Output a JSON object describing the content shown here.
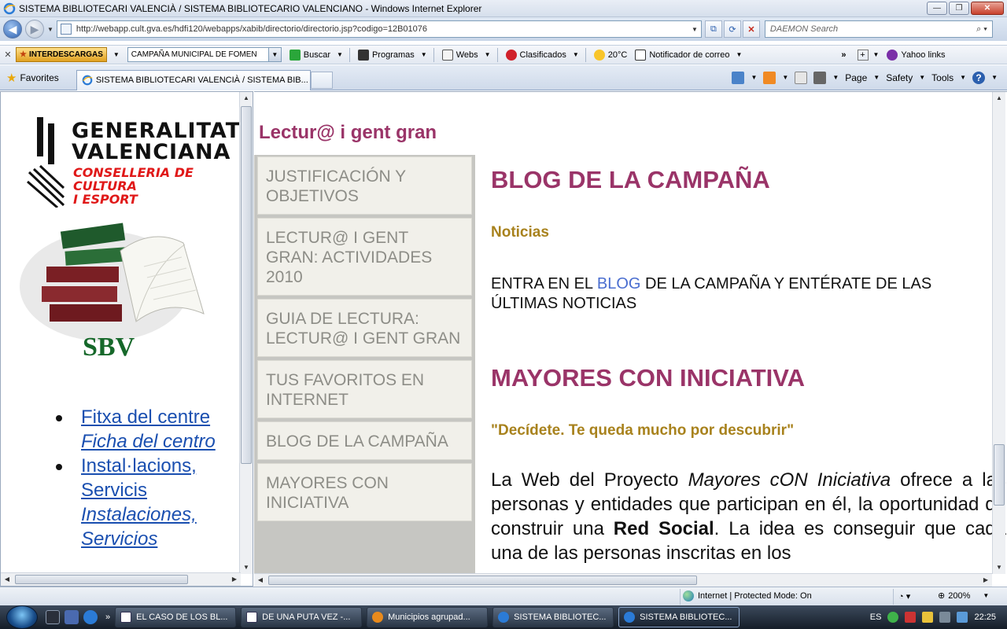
{
  "window": {
    "title": "SISTEMA BIBLIOTECARI VALENCIÀ / SISTEMA BIBLIOTECARIO VALENCIANO - Windows Internet Explorer"
  },
  "address_bar": {
    "url": "http://webapp.cult.gva.es/hdfi120/webapps/xabib/directorio/directorio.jsp?codigo=12B01076"
  },
  "search": {
    "placeholder": "DAEMON Search"
  },
  "toolbar": {
    "brand": "INTERDESCARGAS",
    "combo_value": "CAMPAÑA MUNICIPAL DE FOMEN",
    "buscar": "Buscar",
    "programas": "Programas",
    "webs": "Webs",
    "clasificados": "Clasificados",
    "weather": "20°C",
    "notificador": "Notificador de correo",
    "yahoo": "Yahoo links"
  },
  "tabs": {
    "favorites": "Favorites",
    "active_tab": "SISTEMA BIBLIOTECARI VALENCIÀ / SISTEMA BIB...",
    "page_menu": "Page",
    "safety_menu": "Safety",
    "tools_menu": "Tools"
  },
  "left_frame": {
    "gv_line1": "GENERALITAT",
    "gv_line2": "VALENCIANA",
    "gv_sub1": "CONSELLERIA DE CULTURA",
    "gv_sub2": "I ESPORT",
    "sbv": "SBV",
    "links": [
      {
        "label_va": "Fitxa del centre",
        "label_es": "Ficha del centro"
      },
      {
        "label_va": "Instal·lacions, Servicis",
        "label_es": "Instalaciones, Servicios"
      }
    ]
  },
  "right_frame": {
    "site_title": "Lectur@ i gent gran",
    "menu": [
      "JUSTIFICACIÓN Y OBJETIVOS",
      "LECTUR@ I GENT GRAN: ACTIVIDADES 2010",
      "GUIA DE LECTURA: LECTUR@ I GENT GRAN",
      "TUS FAVORITOS EN INTERNET",
      "BLOG DE LA CAMPAÑA",
      "MAYORES CON INICIATIVA"
    ],
    "blog_heading": "BLOG DE LA CAMPAÑA",
    "noticias": "Noticias",
    "entra_pre": "ENTRA EN EL ",
    "entra_link": "BLOG",
    "entra_post": " DE LA CAMPAÑA Y ENTÉRATE DE LAS ÚLTIMAS NOTICIAS",
    "mayores_heading": "MAYORES CON INICIATIVA",
    "decidete": "\"Decídete. Te queda mucho por descubrir\"",
    "web_p1": "La Web del Proyecto ",
    "web_em": "Mayores cON Iniciativa",
    "web_p2": " ofrece a las personas y entidades que participan en él, la oportunidad de construir una ",
    "web_strong": "Red Social",
    "web_p3": ". La idea es conseguir que cada una de las personas inscritas en los"
  },
  "status": {
    "zone": "Internet | Protected Mode: On",
    "zoom": "200%"
  },
  "taskbar": {
    "tasks": [
      "EL CASO DE LOS BL...",
      "DE UNA PUTA VEZ -...",
      "Municipios agrupad...",
      "SISTEMA BIBLIOTEC...",
      "SISTEMA BIBLIOTEC..."
    ],
    "lang": "ES",
    "time": "22:25"
  },
  "colors": {
    "accent_title": "#9a3468",
    "accent_gold": "#a8821d",
    "link_blue": "#1a4fb0"
  }
}
